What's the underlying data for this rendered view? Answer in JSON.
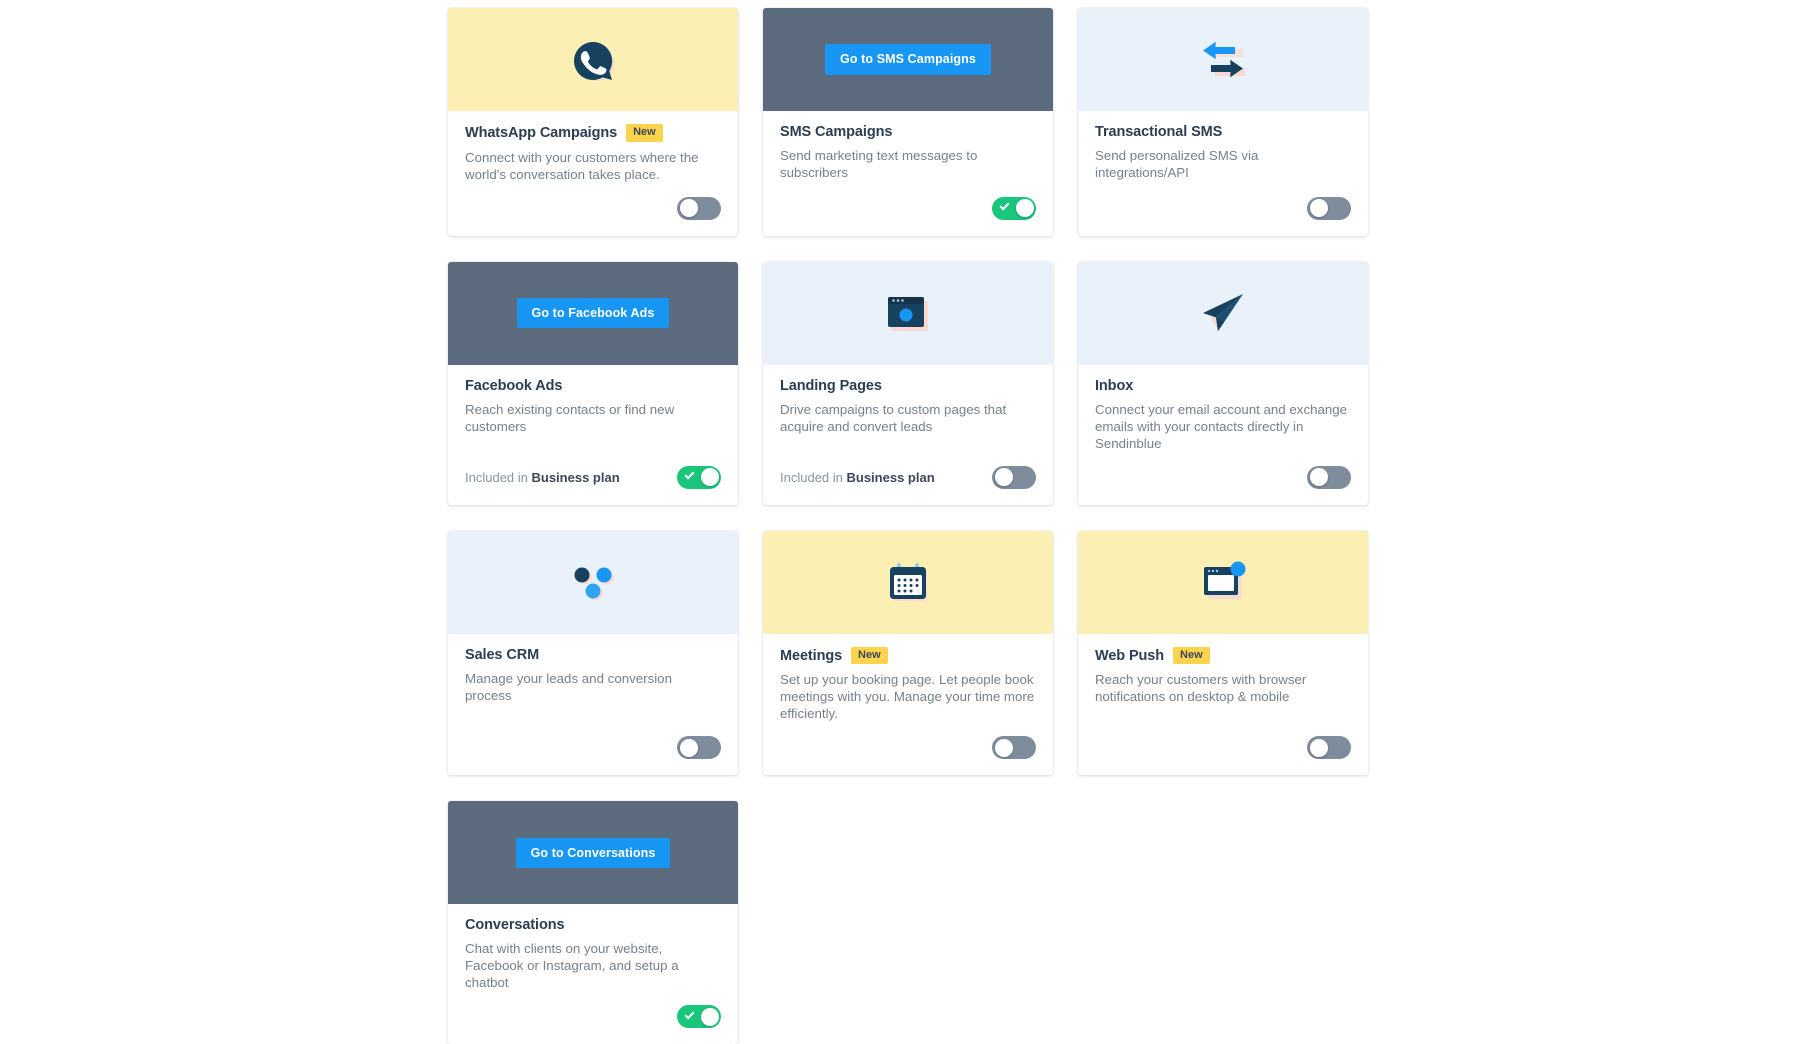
{
  "colors": {
    "hero_yellow": "#fcefb4",
    "hero_blue": "#e9f2fb",
    "hero_overlay": "#5c6b7d",
    "button_blue": "#1896f3",
    "toggle_on": "#1ac67b",
    "toggle_off": "#7f8c9b",
    "badge_yellow": "#fbd34d",
    "title": "#2c3e50",
    "description": "#75818d",
    "icon_navy": "#16415f",
    "icon_blue": "#1896f3"
  },
  "cards": [
    {
      "id": "whatsapp-campaigns",
      "title": "WhatsApp Campaigns",
      "badge": "New",
      "description": "Connect with your customers where the world's conversation takes place.",
      "hero_style": "yellow",
      "icon": "whatsapp-icon",
      "toggle_state": "off",
      "plan_note": null,
      "hover_button": null
    },
    {
      "id": "sms-campaigns",
      "title": "SMS Campaigns",
      "badge": null,
      "description": "Send marketing text messages to subscribers",
      "hero_style": "overlay",
      "icon": "sms-icon",
      "toggle_state": "on",
      "plan_note": null,
      "hover_button": "Go to SMS Campaigns"
    },
    {
      "id": "transactional-sms",
      "title": "Transactional SMS",
      "badge": null,
      "description": "Send personalized SMS via integrations/API",
      "hero_style": "blue",
      "icon": "exchange-arrows-icon",
      "toggle_state": "off",
      "plan_note": null,
      "hover_button": null
    },
    {
      "id": "facebook-ads",
      "title": "Facebook Ads",
      "badge": null,
      "description": "Reach existing contacts or find new customers",
      "hero_style": "overlay",
      "icon": "facebook-ads-icon",
      "toggle_state": "on",
      "plan_note": {
        "prefix": "Included in ",
        "plan": "Business plan"
      },
      "hover_button": "Go to Facebook Ads"
    },
    {
      "id": "landing-pages",
      "title": "Landing Pages",
      "badge": null,
      "description": "Drive campaigns to custom pages that acquire and convert leads",
      "hero_style": "blue",
      "icon": "browser-window-icon",
      "toggle_state": "off",
      "plan_note": {
        "prefix": "Included in ",
        "plan": "Business plan"
      },
      "hover_button": null
    },
    {
      "id": "inbox",
      "title": "Inbox",
      "badge": null,
      "description": "Connect your email account and exchange emails with your contacts directly in Sendinblue",
      "hero_style": "blue",
      "icon": "paper-plane-icon",
      "toggle_state": "off",
      "plan_note": null,
      "hover_button": null
    },
    {
      "id": "sales-crm",
      "title": "Sales CRM",
      "badge": null,
      "description": "Manage your leads and conversion process",
      "hero_style": "blue",
      "icon": "three-dots-icon",
      "toggle_state": "off",
      "plan_note": null,
      "hover_button": null
    },
    {
      "id": "meetings",
      "title": "Meetings",
      "badge": "New",
      "description": "Set up your booking page. Let people book meetings with you. Manage your time more efficiently.",
      "hero_style": "yellow",
      "icon": "calendar-icon",
      "toggle_state": "off",
      "plan_note": null,
      "hover_button": null
    },
    {
      "id": "web-push",
      "title": "Web Push",
      "badge": "New",
      "description": "Reach your customers with browser notifications on desktop & mobile",
      "hero_style": "yellow",
      "icon": "push-notification-icon",
      "toggle_state": "off",
      "plan_note": null,
      "hover_button": null
    },
    {
      "id": "conversations",
      "title": "Conversations",
      "badge": null,
      "description": "Chat with clients on your website, Facebook or Instagram, and setup a chatbot",
      "hero_style": "overlay",
      "icon": "chat-icon",
      "toggle_state": "on",
      "plan_note": null,
      "hover_button": "Go to Conversations"
    }
  ]
}
